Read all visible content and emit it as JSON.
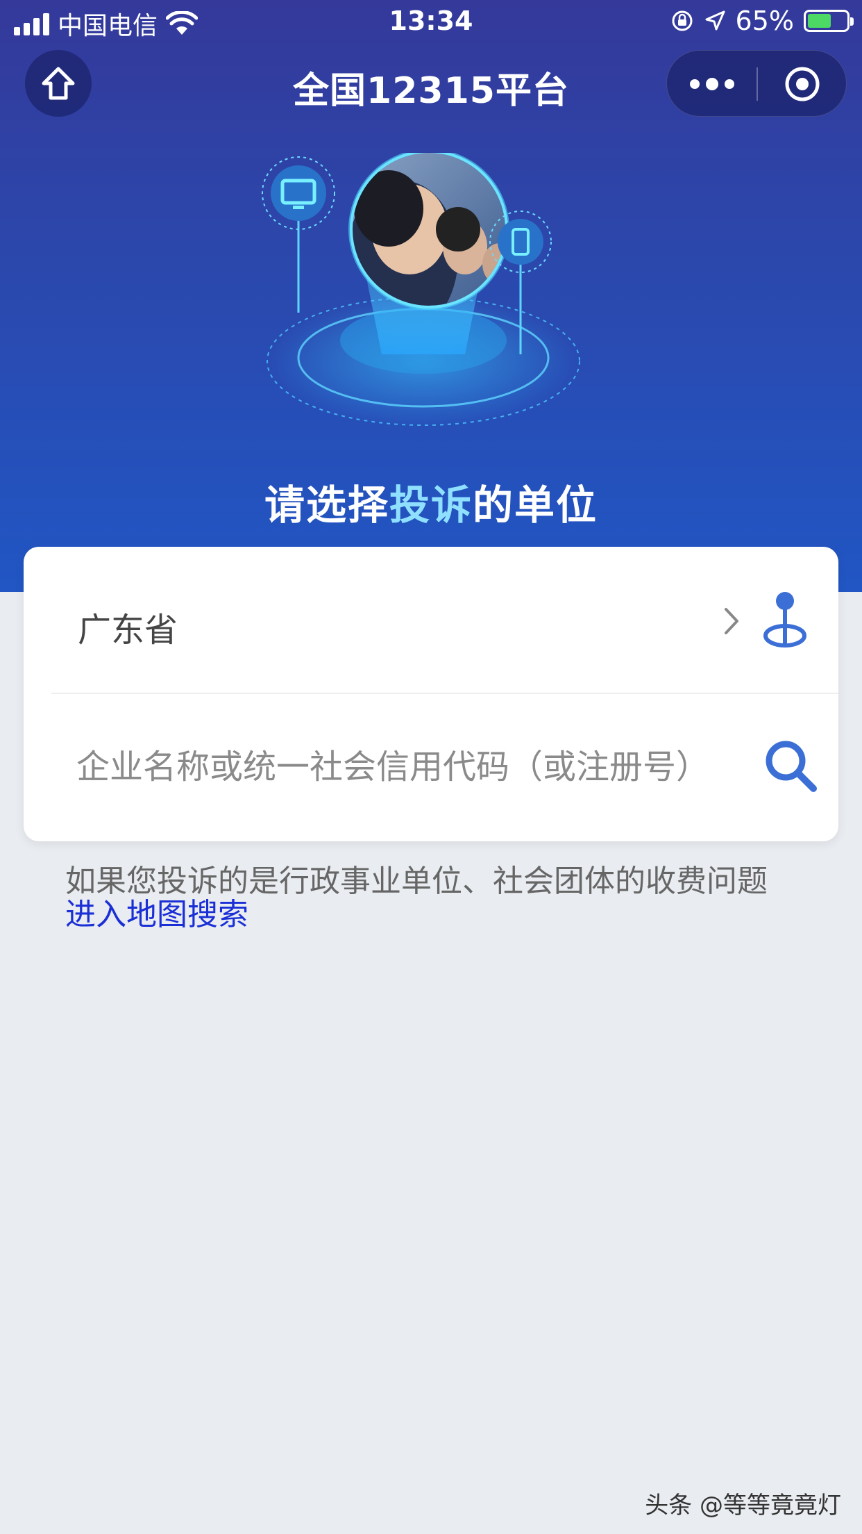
{
  "status_bar": {
    "carrier": "中国电信",
    "time": "13:34",
    "battery": "65%"
  },
  "nav": {
    "title": "全国12315平台",
    "home_icon": "home-icon",
    "more_icon": "more-dots-icon",
    "close_icon": "target-circle-icon"
  },
  "hero": {
    "heading_prefix": "请选择",
    "heading_highlight": "投诉",
    "heading_suffix": "的单位",
    "accent_color": "#8fe0ff"
  },
  "form": {
    "province_value": "广东省",
    "search_placeholder": "企业名称或统一社会信用代码（或注册号）",
    "search_value": ""
  },
  "hint": {
    "text": "如果您投诉的是行政事业单位、社会团体的收费问题",
    "link": "进入地图搜索"
  },
  "watermark": "头条 @等等竟竟灯",
  "colors": {
    "hero_top": "#34399a",
    "hero_bottom": "#2156c4",
    "accent_blue": "#3b6fd6",
    "link_blue": "#1a2fd6",
    "page_bg": "#e9ecf0"
  }
}
